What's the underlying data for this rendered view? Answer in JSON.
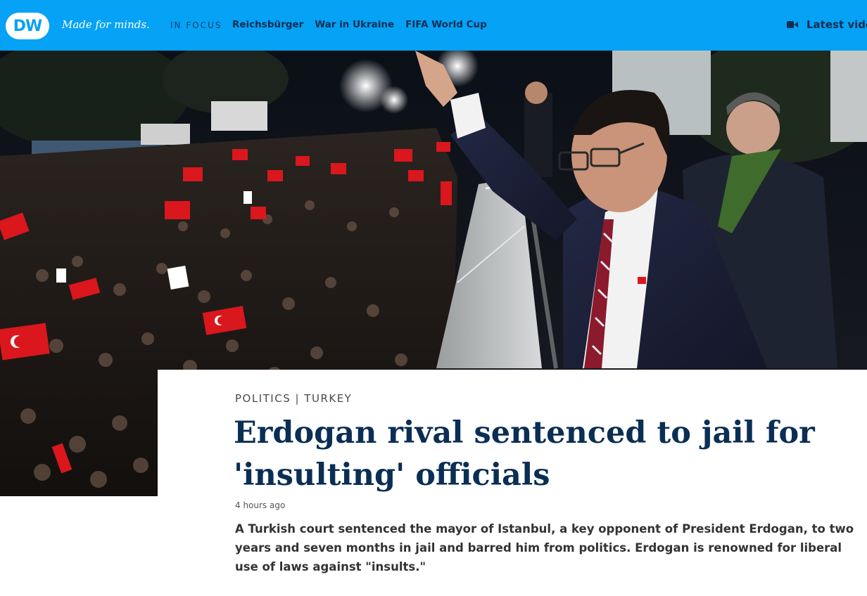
{
  "brand": {
    "logo_text": "DW",
    "tagline": "Made for minds."
  },
  "nav": {
    "focus_label": "IN FOCUS",
    "links": [
      "Reichsbürger",
      "War in Ukraine",
      "FIFA World Cup"
    ],
    "latest_video": "Latest vide"
  },
  "colors": {
    "header_bg": "#05a2f5",
    "headline": "#0a2e54"
  },
  "article": {
    "kicker": "POLITICS | TURKEY",
    "headline": "Erdogan rival sentenced to jail for 'insulting' officials",
    "timestamp": "4 hours ago",
    "teaser": "A Turkish court sentenced the mayor of Istanbul, a key opponent of President Erdogan, to two years and seven months in jail and barred him from politics. Erdogan is renowned for liberal use of laws against \"insults.\""
  },
  "icons": {
    "video": "video-camera-icon"
  }
}
